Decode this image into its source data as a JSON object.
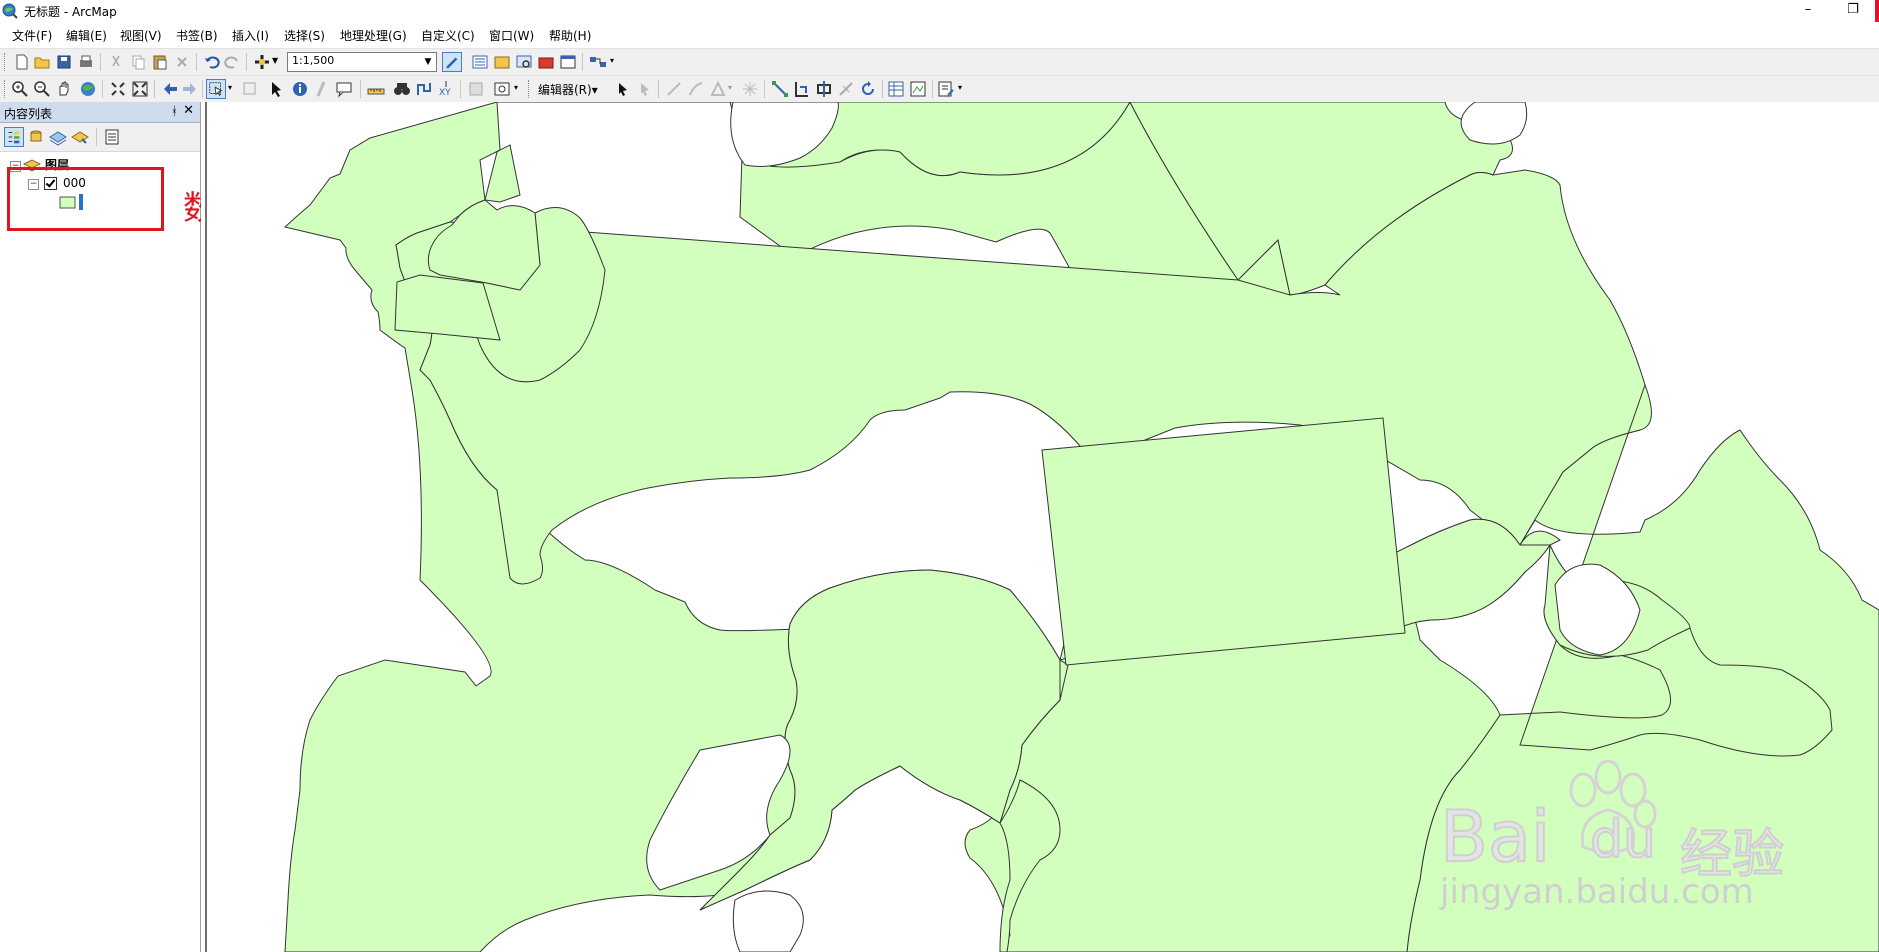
{
  "window": {
    "title": "无标题 - ArcMap",
    "minimize_glyph": "–",
    "restore_glyph": "❐"
  },
  "menu": {
    "items": [
      "文件(F)",
      "编辑(E)",
      "视图(V)",
      "书签(B)",
      "插入(I)",
      "选择(S)",
      "地理处理(G)",
      "自定义(C)",
      "窗口(W)",
      "帮助(H)"
    ]
  },
  "toolbar": {
    "scale_value": "1:1,500",
    "editor_label": "编辑器(R)▾"
  },
  "toc": {
    "title": "内容列表",
    "pin_glyph": "ᚼ",
    "close_glyph": "✕",
    "group_label": "图层",
    "layer_name": "000",
    "layer_checked": true
  },
  "annotation": {
    "label": "数据",
    "color": "#e0161f"
  },
  "map": {
    "fill_color": "#d3ffbe",
    "stroke_color": "#333333"
  },
  "watermark": {
    "brand": "Bai",
    "brand_suffix": "du",
    "product": "经验",
    "url": "jingyan.baidu.com"
  },
  "icons": {
    "app": "arcmap-globe-icon"
  }
}
